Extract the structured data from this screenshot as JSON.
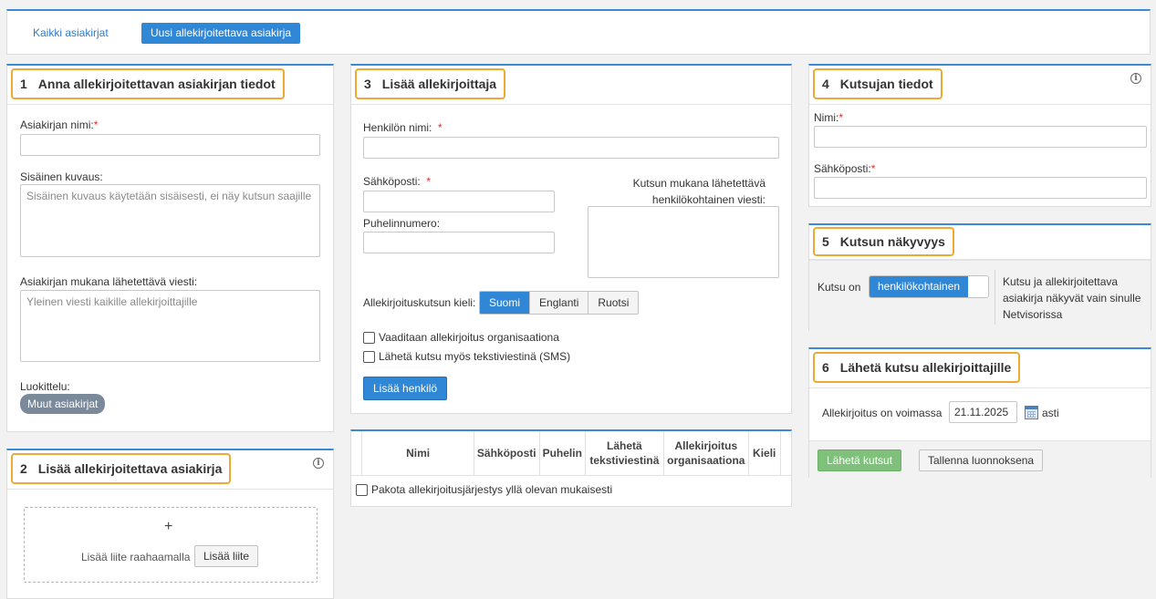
{
  "tabs": {
    "all_docs": "Kaikki asiakirjat",
    "new_doc": "Uusi allekirjoitettava asiakirja"
  },
  "panel1": {
    "num": "1",
    "title": "Anna allekirjoitettavan asiakirjan tiedot",
    "doc_name_label": "Asiakirjan nimi:",
    "required_mark": "*",
    "internal_desc_label": "Sisäinen kuvaus:",
    "internal_desc_placeholder": "Sisäinen kuvaus käytetään sisäisesti, ei näy kutsun saajille",
    "message_label": "Asiakirjan mukana lähetettävä viesti:",
    "message_placeholder": "Yleinen viesti kaikille allekirjoittajille",
    "category_label": "Luokittelu:",
    "category_tag": "Muut asiakirjat"
  },
  "panel2": {
    "num": "2",
    "title": "Lisää allekirjoitettava asiakirja",
    "plus": "+",
    "drop_text": "Lisää liite raahaamalla",
    "attach_button": "Lisää liite"
  },
  "panel3": {
    "num": "3",
    "title": "Lisää allekirjoittaja",
    "name_label": "Henkilön nimi:",
    "email_label": "Sähköposti:",
    "phone_label": "Puhelinnumero:",
    "personal_msg_label_1": "Kutsun mukana lähetettävä",
    "personal_msg_label_2": "henkilökohtainen viesti:",
    "lang_label": "Allekirjoituskutsun kieli:",
    "languages": [
      "Suomi",
      "Englanti",
      "Ruotsi"
    ],
    "require_org": "Vaaditaan allekirjoitus organisaationa",
    "send_sms": "Lähetä kutsu myös tekstiviestinä (SMS)",
    "add_person": "Lisää henkilö",
    "table_headers": {
      "name": "Nimi",
      "email": "Sähköposti",
      "phone": "Puhelin",
      "sms_1": "Lähetä",
      "sms_2": "tekstiviestinä",
      "org_1": "Allekirjoitus",
      "org_2": "organisaationa",
      "lang": "Kieli"
    },
    "force_order": "Pakota allekirjoitusjärjestys yllä olevan mukaisesti"
  },
  "panel4": {
    "num": "4",
    "title": "Kutsujan tiedot",
    "name_label": "Nimi:",
    "email_label": "Sähköposti:",
    "required_mark": "*"
  },
  "panel5": {
    "num": "5",
    "title": "Kutsun näkyvyys",
    "prefix": "Kutsu on",
    "toggle_value": "henkilökohtainen",
    "desc_1": "Kutsu ja allekirjoitettava",
    "desc_2": "asiakirja näkyvät vain sinulle",
    "desc_3": "Netvisorissa"
  },
  "panel6": {
    "num": "6",
    "title": "Lähetä kutsu allekirjoittajille",
    "valid_label": "Allekirjoitus on voimassa",
    "date": "21.11.2025",
    "until": "asti",
    "send_button": "Lähetä kutsut",
    "save_draft_button": "Tallenna luonnoksena"
  }
}
